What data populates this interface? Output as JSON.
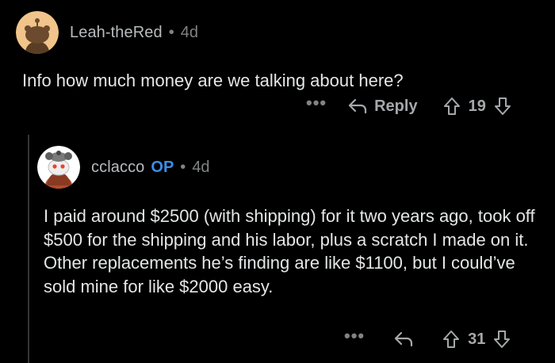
{
  "comments": [
    {
      "username": "Leah-theRed",
      "separator": "•",
      "age": "4d",
      "body": "Info how much money are we talking about here?",
      "actions": {
        "more": "•••",
        "reply_label": "Reply",
        "score": "19"
      }
    },
    {
      "username": "cclacco",
      "badge": "OP",
      "separator": "•",
      "age": "4d",
      "body": "I paid around $2500 (with shipping) for it two years ago, took off $500 for the shipping and his labor, plus a scratch I made on it. Other replacements he’s finding are like $1100, but I could’ve sold mine for like $2000 easy.",
      "actions": {
        "more": "•••",
        "score": "31"
      }
    }
  ],
  "colors": {
    "background": "#000000",
    "op_badge": "#3a8ee6",
    "muted": "#818384"
  }
}
